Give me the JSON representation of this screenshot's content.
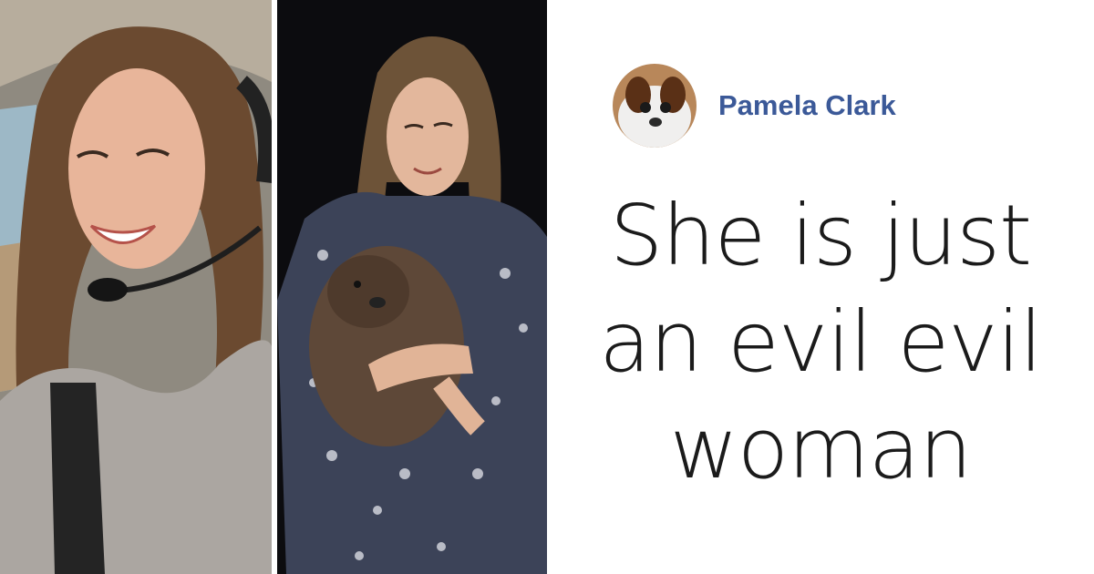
{
  "comment": {
    "author_name": "Pamela Clark",
    "text_lines": [
      "She is just",
      "an evil evil",
      "woman"
    ]
  },
  "photos": {
    "left": "woman-in-cockpit-photo",
    "right": "woman-holding-wombat-photo"
  },
  "colors": {
    "author_name": "#3b5998",
    "quote_text": "#1b1b1b",
    "background": "#ffffff"
  }
}
